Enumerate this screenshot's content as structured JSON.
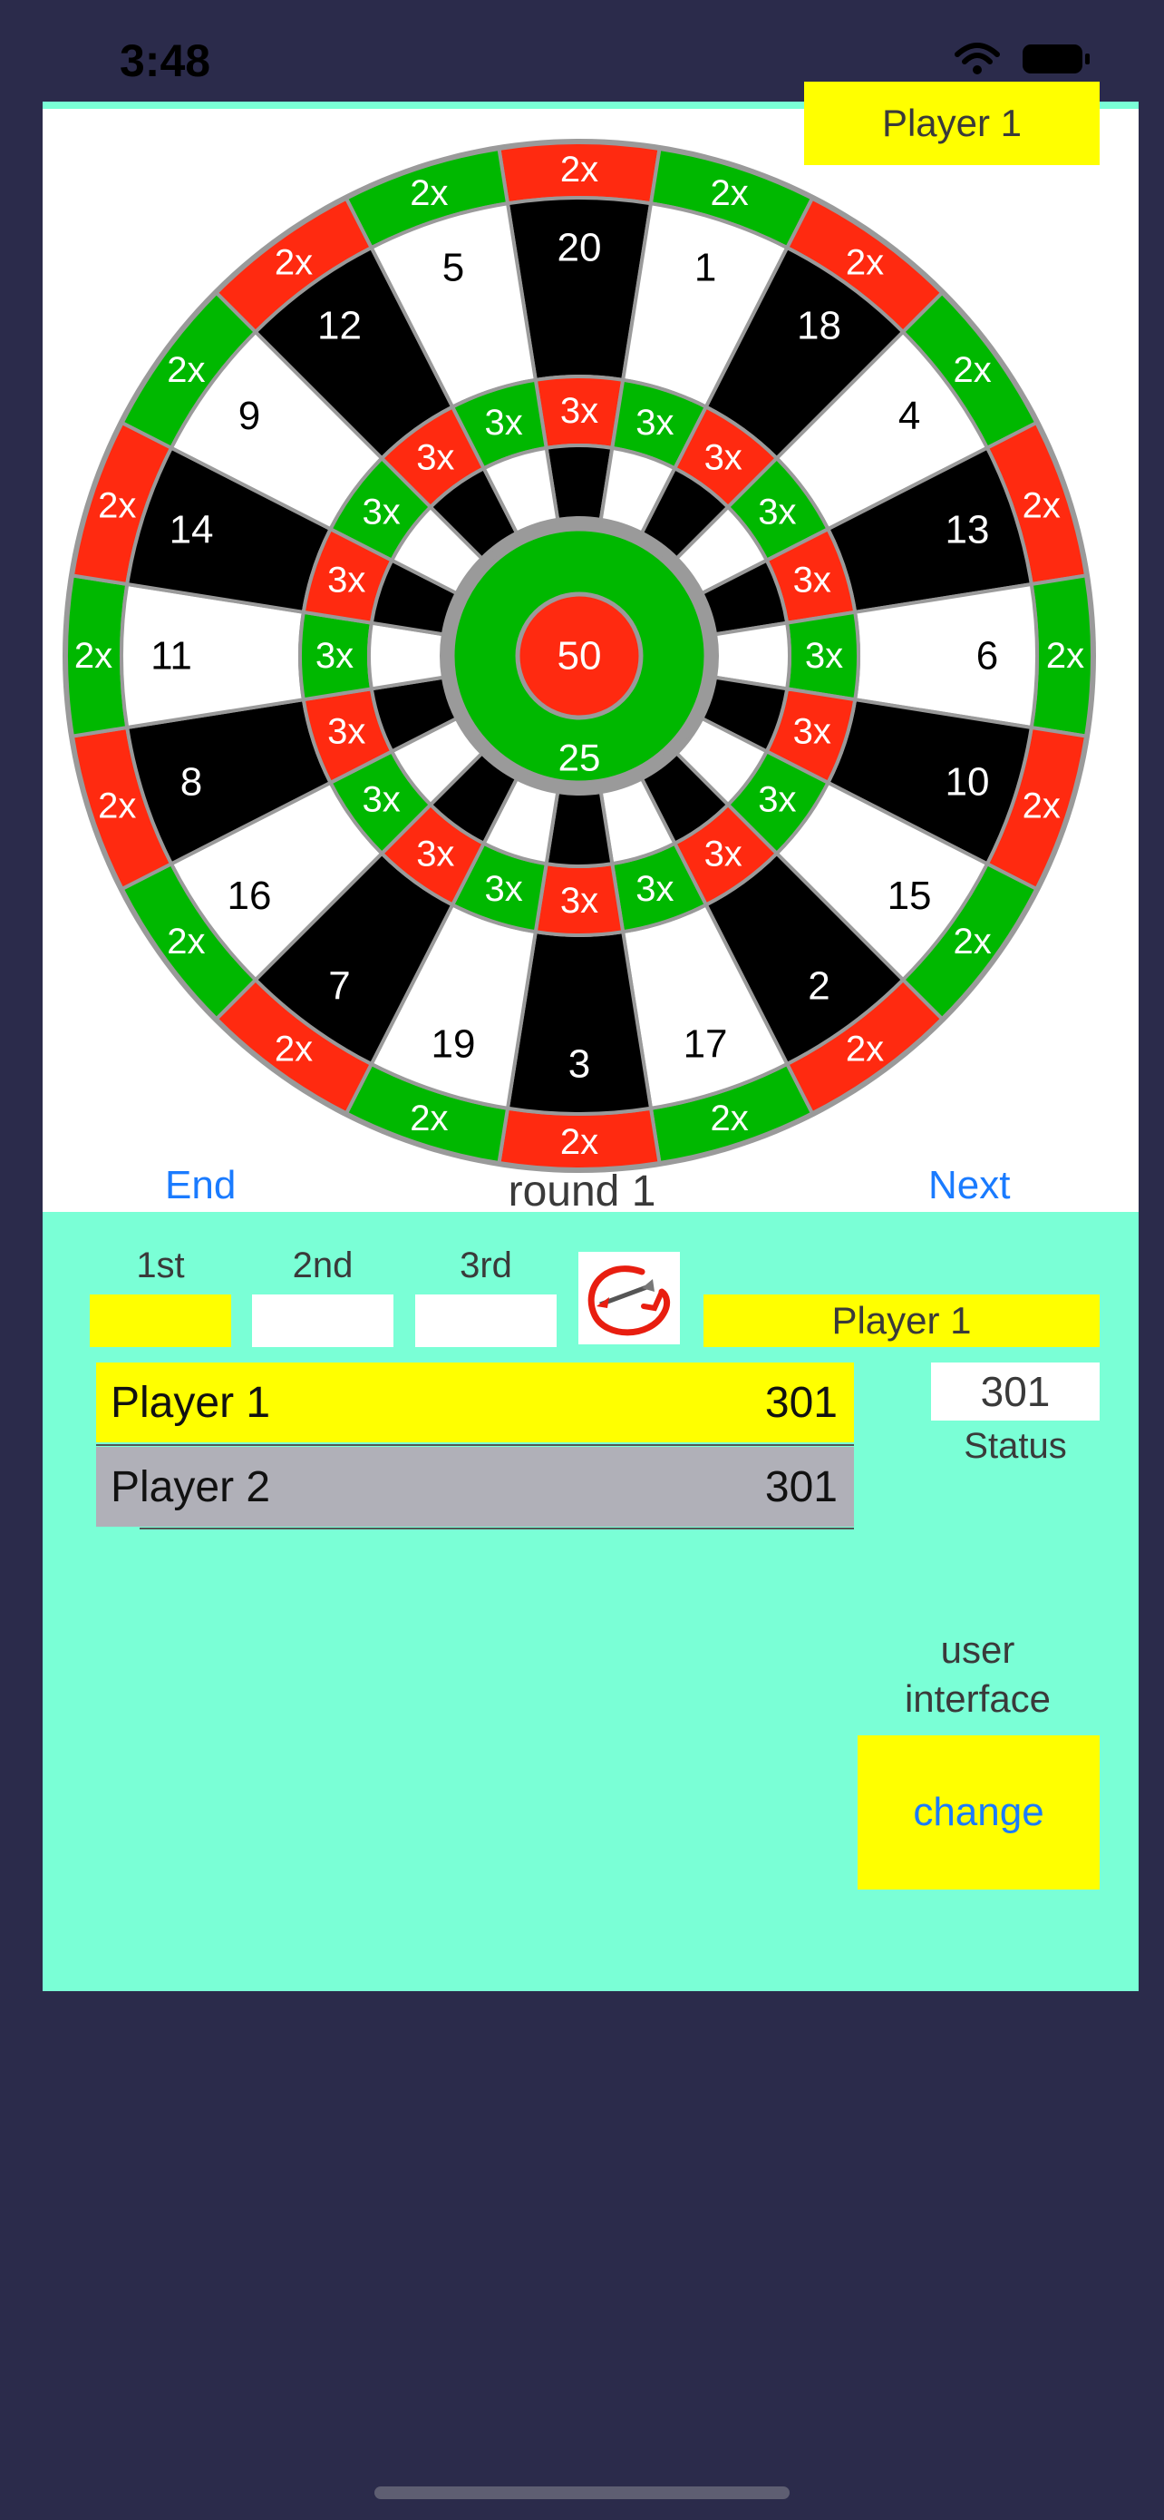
{
  "status_bar": {
    "time": "3:48"
  },
  "top_player_label": "Player 1",
  "board": {
    "colors": {
      "red": "#ff2a10",
      "green": "#00b800",
      "black": "#000000",
      "white": "#ffffff",
      "wire": "#9a9a9a"
    },
    "numbers": [
      20,
      1,
      18,
      4,
      13,
      6,
      10,
      15,
      2,
      17,
      3,
      19,
      7,
      16,
      8,
      11,
      14,
      9,
      12,
      5
    ],
    "double_label": "2x",
    "triple_label": "3x",
    "bull_label": "50",
    "outer_bull_label": "25"
  },
  "controls": {
    "end_label": "End",
    "next_label": "Next",
    "round_label": "round 1"
  },
  "darts": {
    "labels": [
      "1st",
      "2nd",
      "3rd"
    ],
    "icon": "dart-icon"
  },
  "current_player": "Player 1",
  "players": [
    {
      "name": "Player 1",
      "score": "301",
      "color": "#ffff00"
    },
    {
      "name": "Player 2",
      "score": "301",
      "color": "#b0b0b8"
    }
  ],
  "status": {
    "value": "301",
    "label": "Status"
  },
  "ui": {
    "label_line1": "user",
    "label_line2": "interface",
    "change_label": "change"
  }
}
